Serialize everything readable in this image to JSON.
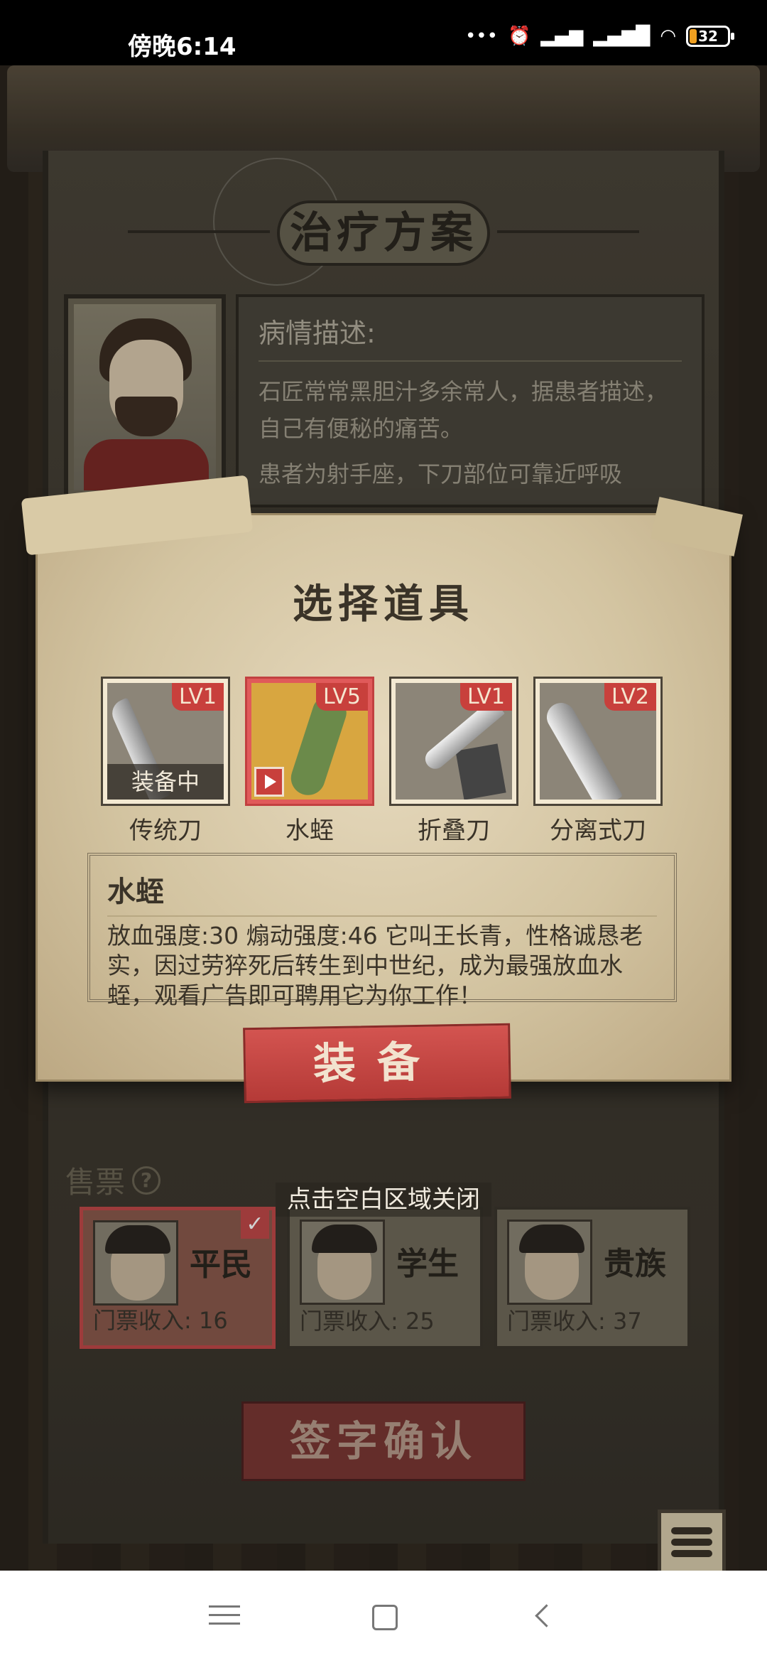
{
  "status_bar": {
    "time": "傍晚6:14",
    "icons": [
      "more-dots-icon",
      "alarm-icon",
      "hd-signal-icon",
      "signal-icon",
      "wifi-icon",
      "battery-icon"
    ],
    "battery_level": "32"
  },
  "plan": {
    "title": "治疗方案"
  },
  "patient": {
    "description_heading": "病情描述:",
    "description_text": "石匠常常黑胆汁多余常人，据患者描述，自己有便秘的痛苦。",
    "description_text2": "患者为射手座，下刀部位可靠近呼吸"
  },
  "tool_select": {
    "title": "选择道具",
    "tools": [
      {
        "name": "传统刀",
        "level": "LV1",
        "status": "装备中"
      },
      {
        "name": "水蛭",
        "level": "LV5",
        "selected": true,
        "ad": true
      },
      {
        "name": "折叠刀",
        "level": "LV1"
      },
      {
        "name": "分离式刀",
        "level": "LV2"
      }
    ],
    "detail": {
      "name": "水蛭",
      "description": "放血强度:30  煽动强度:46  它叫王长青，性格诚恳老实，因过劳猝死后转生到中世纪，成为最强放血水蛭，观看广告即可聘用它为你工作！"
    },
    "equip_button": "装备",
    "close_hint": "点击空白区域关闭"
  },
  "tickets": {
    "label": "售票",
    "help_icon": "question-icon",
    "items": [
      {
        "name": "平民",
        "income": "门票收入: 16",
        "selected": true
      },
      {
        "name": "学生",
        "income": "门票收入: 25"
      },
      {
        "name": "贵族",
        "income": "门票收入: 37"
      }
    ]
  },
  "sign_button": "签字确认",
  "colors": {
    "accent_red": "#c8403c",
    "parchment": "#e6d9bd",
    "dark_bg": "#2b2620"
  }
}
